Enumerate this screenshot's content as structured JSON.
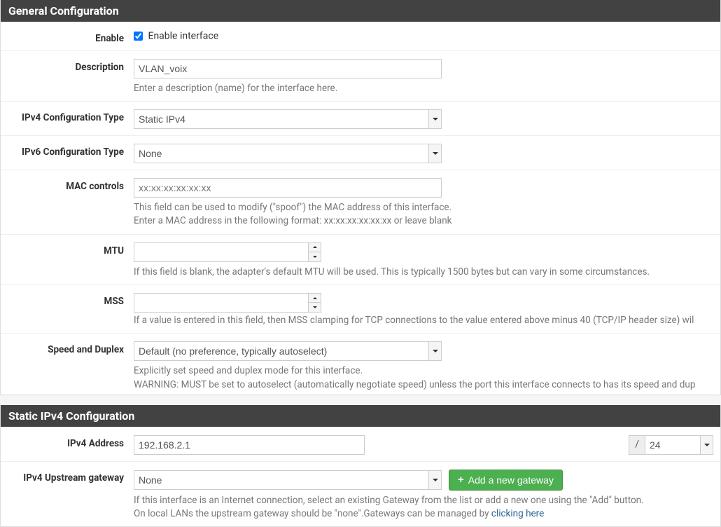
{
  "sections": {
    "general": {
      "title": "General Configuration"
    },
    "static4": {
      "title": "Static IPv4 Configuration"
    }
  },
  "general": {
    "enable": {
      "label": "Enable",
      "checkbox_label": "Enable interface",
      "checked": true
    },
    "description": {
      "label": "Description",
      "value": "VLAN_voix",
      "help": "Enter a description (name) for the interface here."
    },
    "ipv4_type": {
      "label": "IPv4 Configuration Type",
      "value": "Static IPv4"
    },
    "ipv6_type": {
      "label": "IPv6 Configuration Type",
      "value": "None"
    },
    "mac": {
      "label": "MAC controls",
      "placeholder": "xx:xx:xx:xx:xx:xx",
      "value": "",
      "help1": "This field can be used to modify (\"spoof\") the MAC address of this interface.",
      "help2": "Enter a MAC address in the following format: xx:xx:xx:xx:xx:xx or leave blank"
    },
    "mtu": {
      "label": "MTU",
      "value": "",
      "help": "If this field is blank, the adapter's default MTU will be used. This is typically 1500 bytes but can vary in some circumstances."
    },
    "mss": {
      "label": "MSS",
      "value": "",
      "help": "If a value is entered in this field, then MSS clamping for TCP connections to the value entered above minus 40 (TCP/IP header size) wil"
    },
    "speed": {
      "label": "Speed and Duplex",
      "value": "Default (no preference, typically autoselect)",
      "help1": "Explicitly set speed and duplex mode for this interface.",
      "help2": "WARNING: MUST be set to autoselect (automatically negotiate speed) unless the port this interface connects to has its speed and dup"
    }
  },
  "static4": {
    "addr": {
      "label": "IPv4 Address",
      "value": "192.168.2.1",
      "mask_sep": "/",
      "mask": "24"
    },
    "gateway": {
      "label": "IPv4 Upstream gateway",
      "value": "None",
      "button": "Add a new gateway",
      "help1": "If this interface is an Internet connection, select an existing Gateway from the list or add a new one using the \"Add\" button.",
      "help2a": "On local LANs the upstream gateway should be \"none\".Gateways can be managed by ",
      "help2b": "clicking here"
    }
  }
}
